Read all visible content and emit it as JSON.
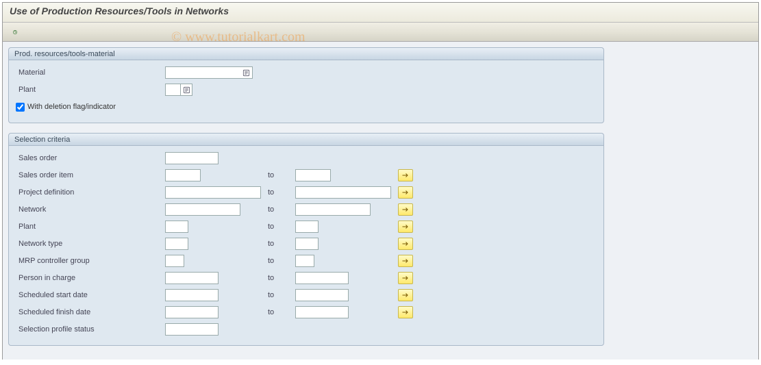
{
  "title": "Use of Production Resources/Tools in Networks",
  "watermark": "© www.tutorialkart.com",
  "panel1": {
    "title": "Prod. resources/tools-material",
    "material_label": "Material",
    "plant_label": "Plant",
    "deletion_label": "With deletion flag/indicator",
    "deletion_checked": true
  },
  "panel2": {
    "title": "Selection criteria",
    "to_label": "to",
    "sales_order": "Sales order",
    "sales_order_item": "Sales order item",
    "project_def": "Project definition",
    "network": "Network",
    "plant": "Plant",
    "network_type": "Network type",
    "mrp_ctrl": "MRP controller group",
    "person": "Person in charge",
    "sched_start": "Scheduled start date",
    "sched_finish": "Scheduled finish date",
    "sel_profile": "Selection profile status"
  }
}
